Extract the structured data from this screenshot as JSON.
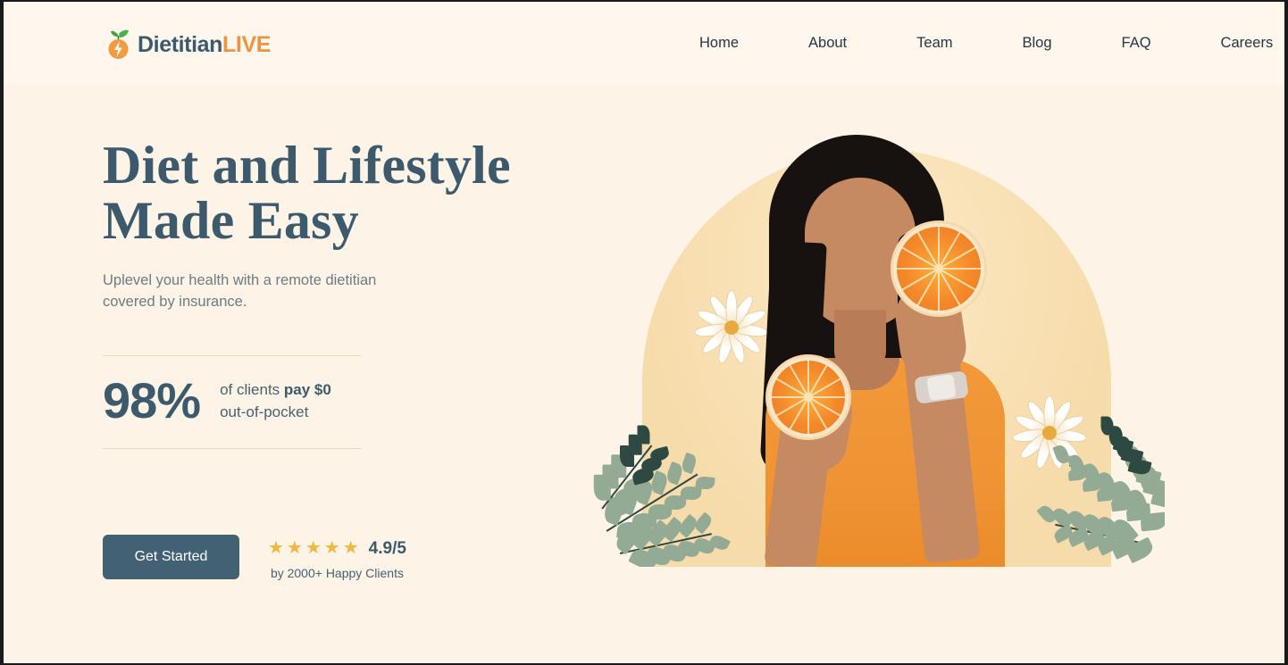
{
  "brand": {
    "name_primary": "Dietitian",
    "name_secondary": "LIVE",
    "icon": "orange-leaf-bolt-icon",
    "color_primary": "#3d5a6c",
    "color_secondary": "#ed9344"
  },
  "nav": {
    "items": [
      {
        "label": "Home"
      },
      {
        "label": "About"
      },
      {
        "label": "Team"
      },
      {
        "label": "Blog"
      },
      {
        "label": "FAQ"
      },
      {
        "label": "Careers"
      }
    ]
  },
  "hero": {
    "headline": "Diet and Lifestyle\nMade Easy",
    "subtitle": "Uplevel your health with a remote dietitian\ncovered by insurance.",
    "stat": {
      "number": "98%",
      "desc_prefix": "of clients ",
      "desc_bold": "pay $0",
      "desc_suffix": "out-of-pocket"
    },
    "cta": {
      "label": "Get Started"
    },
    "rating": {
      "stars": "★★★★★",
      "star_count": 5,
      "score": "4.9/5",
      "subtext": "by 2000+ Happy Clients",
      "star_color": "#f0b840"
    },
    "image": {
      "alt": "woman-holding-orange-slices",
      "background_shape": "arch",
      "background_color": "#f8dfb2",
      "decor": [
        "white-flower",
        "eucalyptus-leaves",
        "orange-slice"
      ]
    }
  },
  "colors": {
    "page_background": "#fdf6ea",
    "header_background": "#fdf7ed",
    "hero_background": "#fdf3e6",
    "slate": "#3d5a6c",
    "button": "#426173",
    "divider": "#e9d7bb",
    "muted_text": "#6e7b85"
  }
}
